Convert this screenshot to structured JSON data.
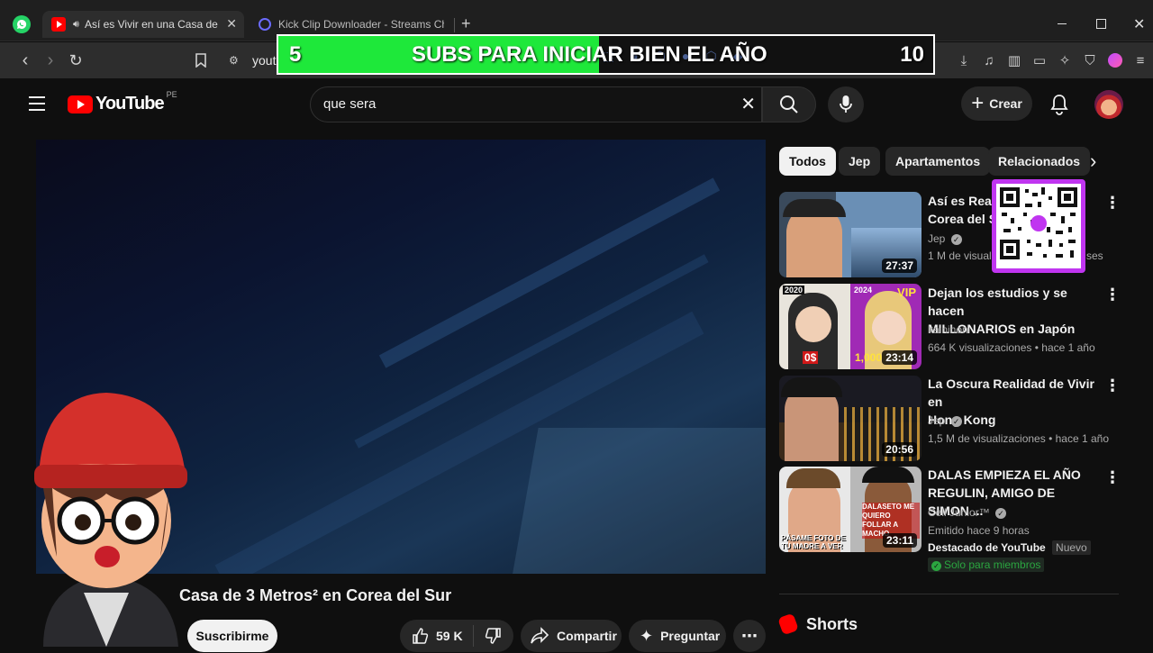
{
  "browser": {
    "tabs": [
      {
        "title": "Así es Vivir en una Casa de 3",
        "active": true
      },
      {
        "title": "Kick Clip Downloader - Streams Char",
        "active": false
      }
    ],
    "url_text": "yout",
    "new_tab_label": "+"
  },
  "banner": {
    "left_count": "5",
    "text": "SUBS PARA INICIAR BIEN EL AÑO",
    "right_count": "10",
    "progress_fraction": 0.49,
    "fill_color": "#1ee83a"
  },
  "yt": {
    "logo_text": "YouTube",
    "country": "PE",
    "search_value": "que sera",
    "create_label": "Crear"
  },
  "chips": [
    "Todos",
    "Jep",
    "Apartamentos",
    "Relacionados"
  ],
  "recommendations": [
    {
      "title": "Así es Realm... Corea del Su...",
      "title_line1": "Así es Realm",
      "title_line2": "Corea del Su",
      "channel": "Jep",
      "verified": true,
      "meta": "1 M de visuali...",
      "meta_tail": "ses",
      "duration": "27:37"
    },
    {
      "title_line1": "Dejan los estudios y se hacen",
      "title_line2": "MILLONARIOS en Japón",
      "channel": "kainihon",
      "verified": false,
      "meta": "664 K visualizaciones • hace 1 año",
      "duration": "23:14",
      "thumb_texts": [
        "2020",
        "2024",
        "VIP",
        "0$",
        "1,000"
      ]
    },
    {
      "title_line1": "La Oscura Realidad de Vivir en",
      "title_line2": "Hong Kong",
      "channel": "Jep",
      "verified": true,
      "meta": "1,5 M de visualizaciones • hace 1 año",
      "duration": "20:56"
    },
    {
      "title_line1": "DALAS EMPIEZA EL AÑO",
      "title_line2": "REGULIN, AMIGO DE SIMON ...",
      "channel": "Cell Junior™",
      "verified": true,
      "meta": "Emitido hace 9 horas",
      "featured": "Destacado de YouTube",
      "new_badge": "Nuevo",
      "members": "Solo para miembros",
      "duration": "23:11",
      "thumb_texts": [
        "PÁSAME FOTO DE TU MADRE A VER",
        "DALASETO ME QUIERO FOLLAR A MACHO"
      ]
    }
  ],
  "shorts_label": "Shorts",
  "video": {
    "title": "Casa de 3 Metros² en Corea del Sur",
    "subscribe_label": "Suscribirme",
    "likes": "59 K",
    "share_label": "Compartir",
    "ask_label": "Preguntar"
  },
  "colors": {
    "brand_red": "#ff0000",
    "bg": "#0f0f0f",
    "chip_bg": "#272727"
  }
}
